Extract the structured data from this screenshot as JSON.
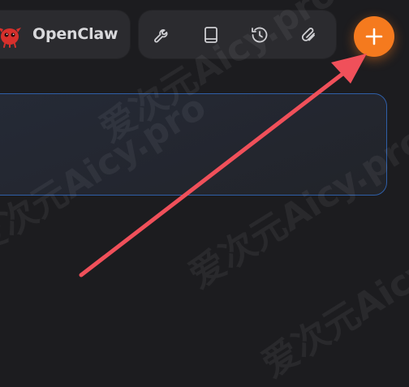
{
  "app": {
    "name": "OpenClaw"
  },
  "toolbar": {
    "tools": [
      {
        "icon": "wrench-icon"
      },
      {
        "icon": "book-icon"
      },
      {
        "icon": "history-icon"
      },
      {
        "icon": "paperclip-icon"
      }
    ],
    "add_icon": "plus-icon"
  },
  "colors": {
    "background": "#1c1c1f",
    "pill": "#2b2b2f",
    "accent": "#f57a1e",
    "input_border": "#2f5fa8",
    "annotation_arrow": "#f0505a"
  },
  "watermark": {
    "text": "爱次元Aicy.pro"
  }
}
